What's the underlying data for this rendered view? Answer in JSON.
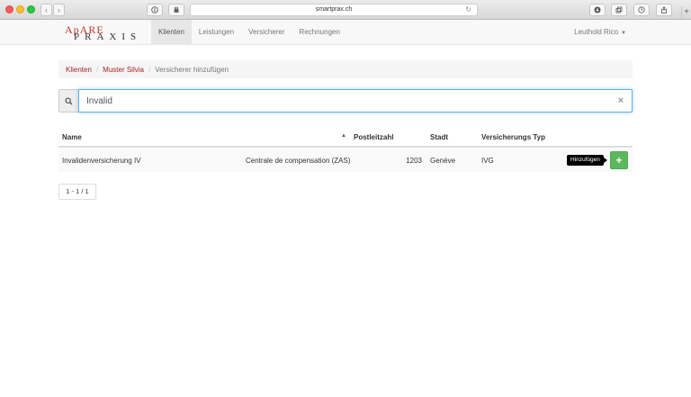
{
  "browser": {
    "url": "smartprax.ch"
  },
  "brand": {
    "top": "ApARE",
    "bottom": "PRAXIS"
  },
  "nav": {
    "items": [
      "Klienten",
      "Leistungen",
      "Versicherer",
      "Rechnungen"
    ],
    "active": "Klienten",
    "user": "Leuthold Rico"
  },
  "breadcrumb": {
    "items": [
      "Klienten",
      "Muster Silvia"
    ],
    "current": "Versicherer hinzufügen"
  },
  "search": {
    "value": "Invalid",
    "clear_label": "×"
  },
  "table": {
    "headers": [
      "Name",
      "Postleitzahl",
      "Stadt",
      "Versicherungs Typ"
    ],
    "rows": [
      {
        "name": "Invalidenversicherung IV",
        "institution": "Centrale de compensation (ZAS)",
        "postleitzahl": "1203",
        "stadt": "Genève",
        "typ": "IVG",
        "action_tooltip": "Hinzufügen",
        "action_label": "+"
      }
    ]
  },
  "pager": {
    "label": "1 - 1 / 1"
  },
  "colors": {
    "accent": "#a0252b",
    "add_button": "#5cb85c"
  }
}
